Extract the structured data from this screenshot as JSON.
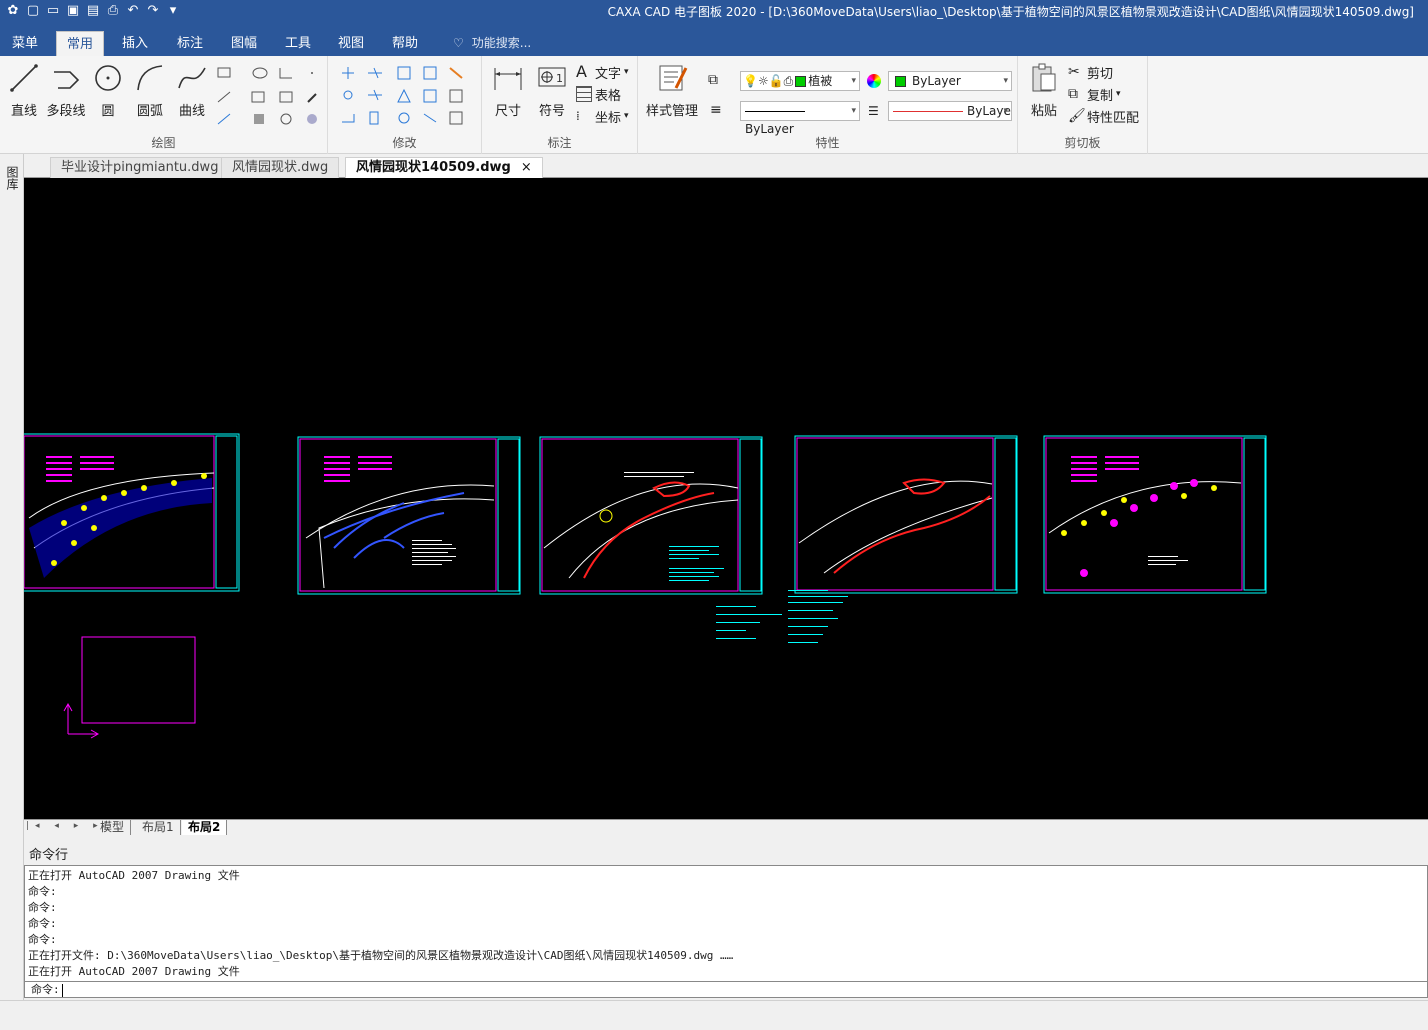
{
  "titlebar": {
    "title": "CAXA CAD 电子图板 2020 - [D:\\360MoveData\\Users\\liao_\\Desktop\\基于植物空间的风景区植物景观改造设计\\CAD图纸\\风情园现状140509.dwg]"
  },
  "menu_tabs": [
    "菜单",
    "常用",
    "插入",
    "标注",
    "图幅",
    "工具",
    "视图",
    "帮助"
  ],
  "active_tab": "常用",
  "search_placeholder": "功能搜索...",
  "ribbon": {
    "draw": {
      "label": "绘图",
      "buttons": [
        "直线",
        "多段线",
        "圆",
        "圆弧",
        "曲线"
      ]
    },
    "modify": {
      "label": "修改"
    },
    "annotate": {
      "label": "标注",
      "buttons": [
        "尺寸",
        "符号"
      ],
      "small": [
        "文字",
        "表格",
        "坐标"
      ]
    },
    "properties": {
      "label": "特性",
      "style_manager": "样式管理",
      "layer_name": "植被",
      "color_value": "ByLayer",
      "linetype_value": "ByLayer",
      "lineweight_value": "ByLaye",
      "swatch_color": "#00cc00"
    },
    "clipboard": {
      "label": "剪切板",
      "paste": "粘贴",
      "small": [
        "剪切",
        "复制",
        "特性匹配"
      ]
    }
  },
  "left_strip_label": "图库",
  "doc_tabs": [
    {
      "label": "毕业设计pingmiantu.dwg",
      "active": false
    },
    {
      "label": "风情园现状.dwg",
      "active": false
    },
    {
      "label": "风情园现状140509.dwg",
      "active": true
    }
  ],
  "doc_close": "×",
  "layout_tabs": [
    "模型",
    "布局1",
    "布局2"
  ],
  "active_layout": "布局2",
  "layout_nav": "|◂ ◂ ▸ ▸|",
  "command": {
    "header": "命令行",
    "lines": [
      "正在打开 AutoCAD 2007 Drawing 文件",
      "命令:",
      "命令:",
      "命令:",
      "命令:",
      "正在打开文件: D:\\360MoveData\\Users\\liao_\\Desktop\\基于植物空间的风景区植物景观改造设计\\CAD图纸\\风情园现状140509.dwg ……",
      "正在打开 AutoCAD 2007 Drawing 文件"
    ],
    "prompt": "命令:"
  },
  "colors": {
    "accent": "#2b579a",
    "canvas_bg": "#000000",
    "frame_magenta": "#ff00ff",
    "frame_cyan": "#00ffff",
    "yellow": "#ffff00",
    "blue": "#0000ff",
    "red": "#ff0000"
  }
}
